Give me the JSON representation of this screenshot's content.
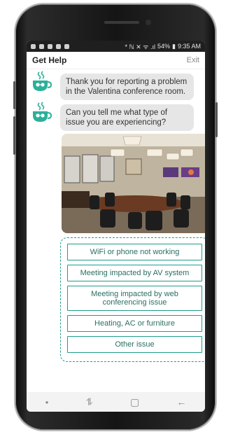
{
  "status_bar": {
    "indicators": "* ℕ ✕ ᯤ .ıl",
    "battery": "54%",
    "time": "9:35 AM"
  },
  "app_bar": {
    "title": "Get Help",
    "exit_label": "Exit"
  },
  "messages": [
    {
      "text": "Thank you for reporting a problem in the Valentina conference room.",
      "avatar_icon": "coffee-cup-icon"
    },
    {
      "text": "Can you tell me what type of issue you are experiencing?",
      "avatar_icon": "coffee-cup-icon"
    }
  ],
  "photo": {
    "subject": "conference-room-photo"
  },
  "options": [
    {
      "label": "WiFi or phone not working"
    },
    {
      "label": "Meeting impacted by AV system"
    },
    {
      "label": "Meeting impacted by web conferencing issue"
    },
    {
      "label": "Heating, AC or furniture"
    },
    {
      "label": "Other issue"
    }
  ],
  "nav_bar": {
    "recent_icon": "recent-apps-icon",
    "home_icon": "home-icon",
    "back_icon": "back-icon"
  },
  "colors": {
    "accent": "#1e9c8b",
    "bubble": "#e6e6e6",
    "avatar": "#2bb09a"
  }
}
